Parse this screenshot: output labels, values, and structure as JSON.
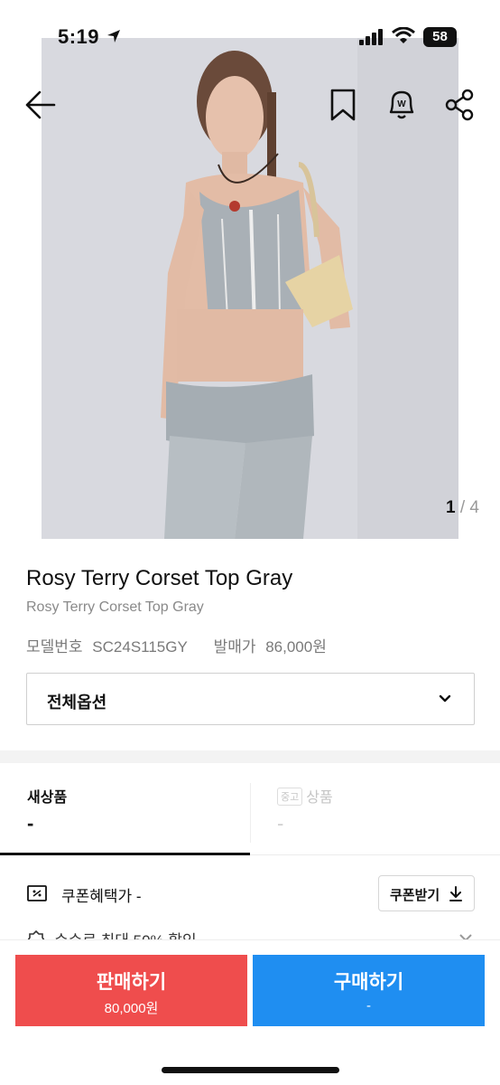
{
  "status_bar": {
    "time": "5:19",
    "battery": "58"
  },
  "gallery": {
    "current": "1",
    "separator": "/",
    "total": "4"
  },
  "product": {
    "title": "Rosy Terry Corset Top Gray",
    "subtitle": "Rosy Terry Corset Top Gray",
    "model_label": "모델번호",
    "model_value": "SC24S115GY",
    "release_label": "발매가",
    "release_value": "86,000원"
  },
  "option_select": {
    "label": "전체옵션"
  },
  "tabs": {
    "new": {
      "title": "새상품",
      "value": "-"
    },
    "used": {
      "badge": "중고",
      "title": "상품",
      "value": "-"
    }
  },
  "coupon": {
    "label": "쿠폰혜택가 -",
    "button": "쿠폰받기"
  },
  "discount": {
    "text": "수수료 최대 50% 할인"
  },
  "bottom": {
    "sell_label": "판매하기",
    "sell_price": "80,000원",
    "buy_label": "구매하기",
    "buy_price": "-"
  },
  "colors": {
    "sell": "#ef4d4d",
    "buy": "#1f8ef1"
  },
  "icons": [
    "back-arrow-icon",
    "bookmark-icon",
    "alert-bell-icon",
    "share-icon",
    "coupon-icon",
    "download-icon",
    "chevron-down-icon"
  ]
}
